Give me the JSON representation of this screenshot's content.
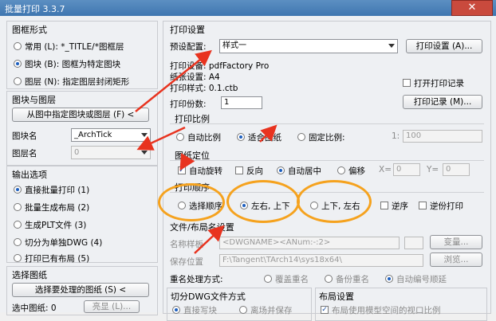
{
  "window": {
    "title": "批量打印 3.3.7",
    "close": "✕"
  },
  "left": {
    "frame_type": {
      "title": "图框形式",
      "options": [
        "常用 (L): *_TITLE/*图框层",
        "图块 (B): 图框为特定图块",
        "图层 (N): 指定图层封闭矩形"
      ],
      "selected": 1
    },
    "block_layer": {
      "title": "图块与图层",
      "pick_button": "从图中指定图块或图层 (F) <",
      "block_label": "图块名",
      "block_value": "_ArchTick",
      "layer_label": "图层名",
      "layer_value": "0"
    },
    "output": {
      "title": "输出选项",
      "options": [
        "直接批量打印 (1)",
        "批量生成布局 (2)",
        "生成PLT文件 (3)",
        "切分为单独DWG (4)",
        "打印已有布局 (5)"
      ],
      "selected": 0
    },
    "select": {
      "title": "选择图纸",
      "select_button": "选择要处理的图纸 (S) <",
      "count_label": "选中图纸: 0",
      "highlight_button": "亮显 (L)..."
    }
  },
  "right": {
    "print_settings": {
      "title": "打印设置",
      "preset_label": "预设配置:",
      "preset_value": "样式一",
      "print_settings_button": "打印设置 (A)...",
      "device_line": "打印设备: pdfFactory Pro",
      "paper_line": "纸张设置: A4",
      "style_line": "打印样式: 0.1.ctb",
      "copies_label": "打印份数:",
      "copies_value": "1",
      "open_log_label": "打开打印记录",
      "open_log_checked": false,
      "log_button": "打印记录 (M)..."
    },
    "scale": {
      "title": "打印比例",
      "options": [
        "自动比例",
        "适合图纸",
        "固定比例:"
      ],
      "selected": 1,
      "ratio_prefix": "1:",
      "ratio_value": "100"
    },
    "position": {
      "title": "图纸定位",
      "auto_rotate_label": "自动旋转",
      "auto_rotate_checked": true,
      "reverse_label": "反向",
      "reverse_checked": false,
      "options": [
        "自动居中",
        "偏移"
      ],
      "selected": 0,
      "x_label": "X=",
      "x_value": "0",
      "y_label": "Y=",
      "y_value": "0"
    },
    "order": {
      "title": "打印顺序",
      "options": [
        "选择顺序",
        "左右, 上下",
        "上下, 左右"
      ],
      "selected": 1,
      "reverse_label": "逆序",
      "reverse_checked": false,
      "reverse_print_label": "逆份打印",
      "reverse_print_checked": false
    },
    "naming": {
      "title": "文件/布局名设置",
      "name_label": "名称样板",
      "name_value": "<DWGNAME><ANum:-:2>",
      "change_button": "变量...",
      "path_label": "保存位置",
      "path_value": "F:\\Tangent\\TArch14\\sys18x64\\",
      "browse_button": "浏览...",
      "dup_label": "重名处理方式:",
      "dup_options": [
        "覆盖重名",
        "备份重名",
        "自动编号顺延"
      ],
      "dup_selected": 2
    },
    "dwg_split": {
      "title": "切分DWG文件方式",
      "options": [
        "直接写块",
        "离场并保存"
      ]
    },
    "layout": {
      "title": "布局设置",
      "option": "布局使用模型空间的视口比例"
    }
  },
  "colors": {
    "annotation": "#f5a21e",
    "arrow": "#e8331f",
    "accent": "#1d5fbf"
  }
}
